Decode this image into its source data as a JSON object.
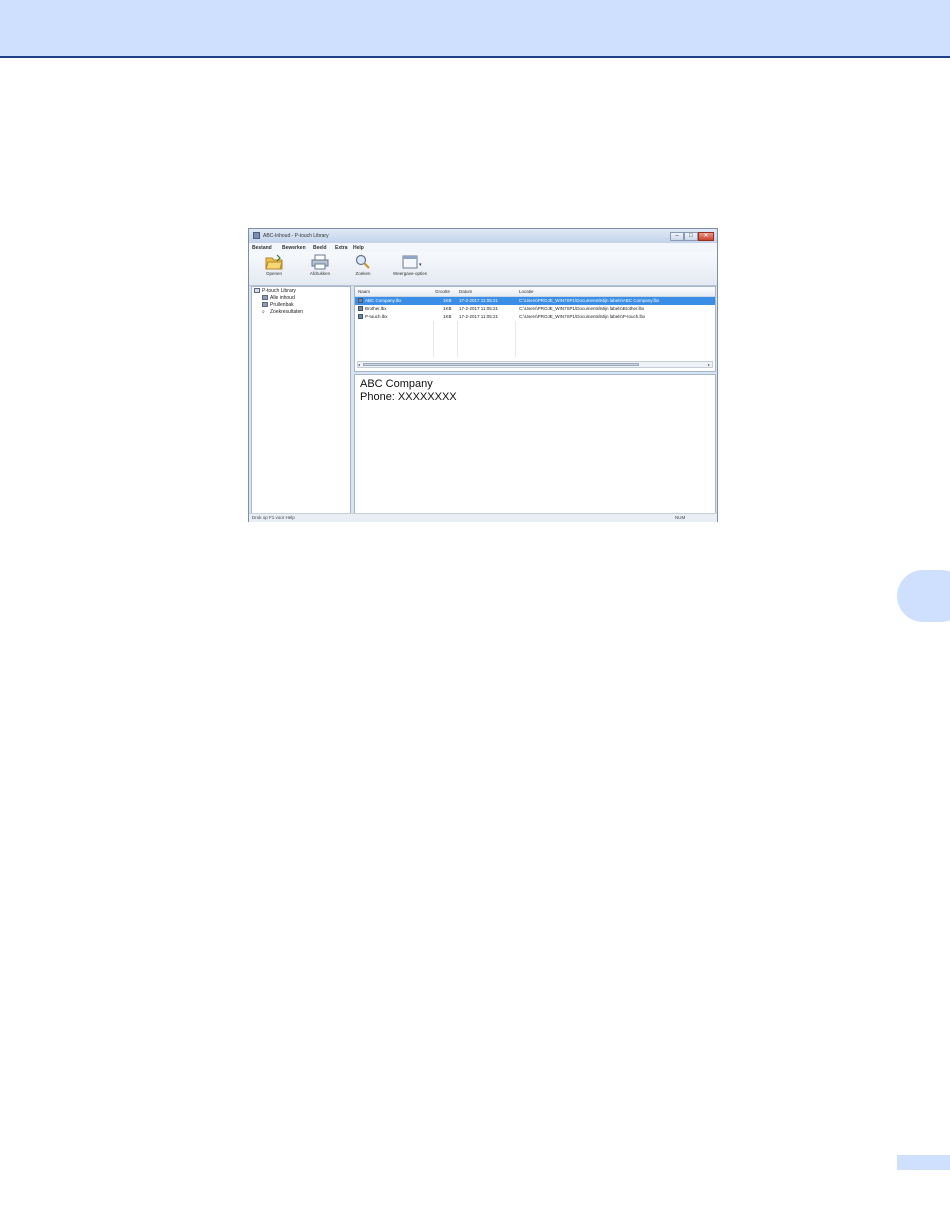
{
  "window": {
    "title": "ABC-Inhoud - P-touch Library",
    "menu": [
      "Bestand",
      "Bewerken",
      "Beeld",
      "Extra",
      "Help"
    ],
    "toolbar": [
      {
        "label": "Openen",
        "icon": "open-folder-icon"
      },
      {
        "label": "Afdrukken",
        "icon": "printer-icon"
      },
      {
        "label": "Zoeken",
        "icon": "magnifier-icon"
      },
      {
        "label": "Weergave-opties",
        "icon": "view-style-icon"
      }
    ],
    "tree": [
      "P-touch Library",
      "Alle inhoud",
      "Prullenbak",
      "Zoekresultaten"
    ],
    "list": {
      "columns": [
        "Naam",
        "Grootte",
        "Datum",
        "Locatie"
      ],
      "rows": [
        {
          "name": "ABC Company.lbx",
          "size": "1KB",
          "date": "17-2-2017 11:05:21",
          "location": "C:\\Users\\PROJE_WIN7SP1\\Documents\\Mijn labels\\ABC Company.lbx",
          "selected": true
        },
        {
          "name": "Brother.lbx",
          "size": "1KB",
          "date": "17-2-2017 11:05:21",
          "location": "C:\\Users\\PROJE_WIN7SP1\\Documents\\Mijn labels\\Brother.lbx",
          "selected": false
        },
        {
          "name": "P-touch.lbx",
          "size": "1KB",
          "date": "17-2-2017 11:05:21",
          "location": "C:\\Users\\PROJE_WIN7SP1\\Documents\\Mijn labels\\P-touch.lbx",
          "selected": false
        }
      ]
    },
    "preview": {
      "line1": "ABC Company",
      "line2": "Phone: XXXXXXXX"
    },
    "status": {
      "left": "Druk op F1 voor Help",
      "right": "NUM"
    }
  }
}
